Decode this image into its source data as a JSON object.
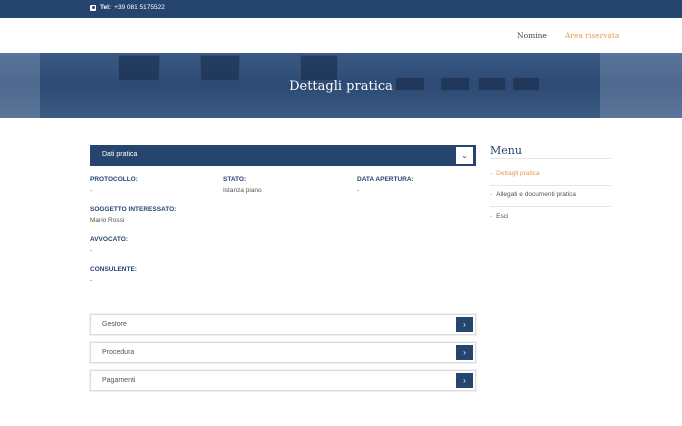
{
  "topbar": {
    "phone_label": "Tel:",
    "phone_number": "+39 081 5175522"
  },
  "nav": {
    "items": [
      {
        "label": "Nomine"
      },
      {
        "label": "Area riservata"
      }
    ]
  },
  "hero": {
    "title": "Dettagli pratica"
  },
  "accordion": {
    "title": "Dati pratica"
  },
  "fields": {
    "protocollo": {
      "label": "PROTOCOLLO:",
      "value": "-"
    },
    "stato": {
      "label": "STATO:",
      "value": "Istanza piano"
    },
    "data_apertura": {
      "label": "DATA APERTURA:",
      "value": "-"
    },
    "soggetto": {
      "label": "SOGGETTO INTERESSATO:",
      "value": "Mario Rossi"
    },
    "avvocato": {
      "label": "AVVOCATO:",
      "value": "-"
    },
    "consulente": {
      "label": "CONSULENTE:",
      "value": "-"
    }
  },
  "sidebar": {
    "title": "Menu",
    "bullet": "-",
    "items": [
      {
        "label": "Dettagli pratica",
        "active": true
      },
      {
        "label": "Allegati e documenti pratica",
        "active": false
      },
      {
        "label": "Esci",
        "active": false
      }
    ]
  },
  "sections": [
    {
      "label": "Gestore"
    },
    {
      "label": "Procedura"
    },
    {
      "label": "Pagamenti"
    }
  ],
  "colors": {
    "primary": "#26456e",
    "accent": "#e39a55"
  },
  "icons": {
    "phone": "phone-icon",
    "toggle": "chevron-down-icon",
    "section": "chevron-right-icon"
  }
}
